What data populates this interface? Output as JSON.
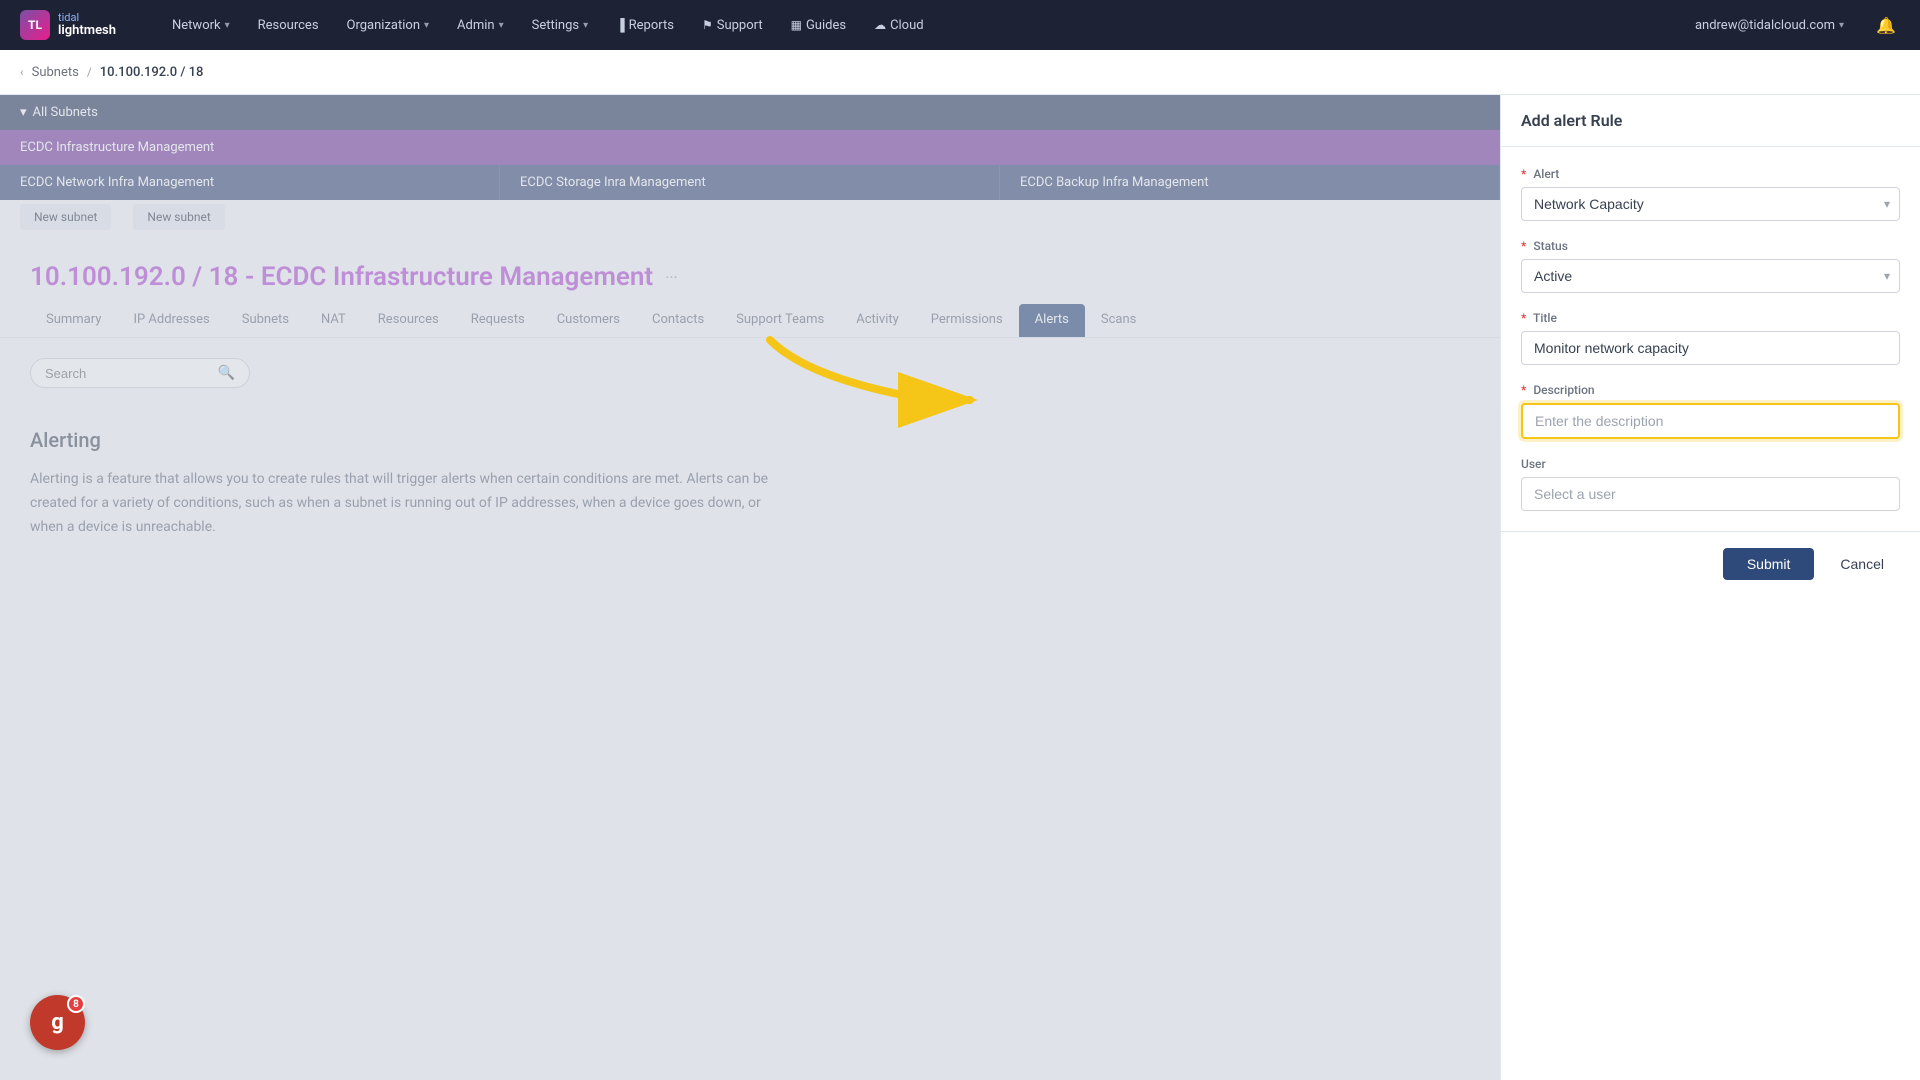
{
  "app": {
    "logo_line1": "tidal",
    "logo_line2": "lightmesh"
  },
  "navbar": {
    "items": [
      {
        "label": "Network",
        "has_caret": true
      },
      {
        "label": "Resources",
        "has_caret": false
      },
      {
        "label": "Organization",
        "has_caret": true
      },
      {
        "label": "Admin",
        "has_caret": true
      },
      {
        "label": "Settings",
        "has_caret": true
      },
      {
        "label": "Reports",
        "has_caret": false
      },
      {
        "label": "Support",
        "has_caret": false
      },
      {
        "label": "Guides",
        "has_caret": false
      },
      {
        "label": "Cloud",
        "has_caret": false
      }
    ],
    "user_email": "andrew@tidalcloud.com"
  },
  "breadcrumb": {
    "parent": "Subnets",
    "current": "10.100.192.0 / 18"
  },
  "subnet_tree": {
    "all_subnets": "All Subnets",
    "row1": "ECDC Infrastructure Management",
    "row2_cells": [
      "ECDC Network Infra Management",
      "ECDC Storage Inra Management",
      "ECDC Backup Infra Management"
    ],
    "new_subnet_labels": [
      "New subnet",
      "New subnet"
    ]
  },
  "page": {
    "title": "10.100.192.0 / 18 - ECDC Infrastructure Management"
  },
  "tabs": [
    {
      "label": "Summary"
    },
    {
      "label": "IP Addresses"
    },
    {
      "label": "Subnets"
    },
    {
      "label": "NAT"
    },
    {
      "label": "Resources"
    },
    {
      "label": "Requests"
    },
    {
      "label": "Customers"
    },
    {
      "label": "Contacts"
    },
    {
      "label": "Support Teams"
    },
    {
      "label": "Activity"
    },
    {
      "label": "Permissions"
    },
    {
      "label": "Alerts",
      "active": true
    },
    {
      "label": "Scans"
    }
  ],
  "search": {
    "placeholder": "Search"
  },
  "alerting": {
    "title": "Alerting",
    "description": "Alerting is a feature that allows you to create rules that will trigger alerts when certain conditions are met. Alerts can be created for a variety of conditions, such as when a subnet is running out of IP addresses, when a device goes down, or when a device is unreachable."
  },
  "panel": {
    "header": "Add alert Rule",
    "alert_label": "Alert",
    "alert_value": "Network Capacity",
    "status_label": "Status",
    "status_value": "Active",
    "title_label": "Title",
    "title_value": "Monitor network capacity",
    "description_label": "Description",
    "description_placeholder": "Enter the description",
    "user_label": "User",
    "user_placeholder": "Select a user",
    "submit_label": "Submit",
    "cancel_label": "Cancel"
  },
  "avatar": {
    "letter": "g",
    "badge_count": "8"
  }
}
